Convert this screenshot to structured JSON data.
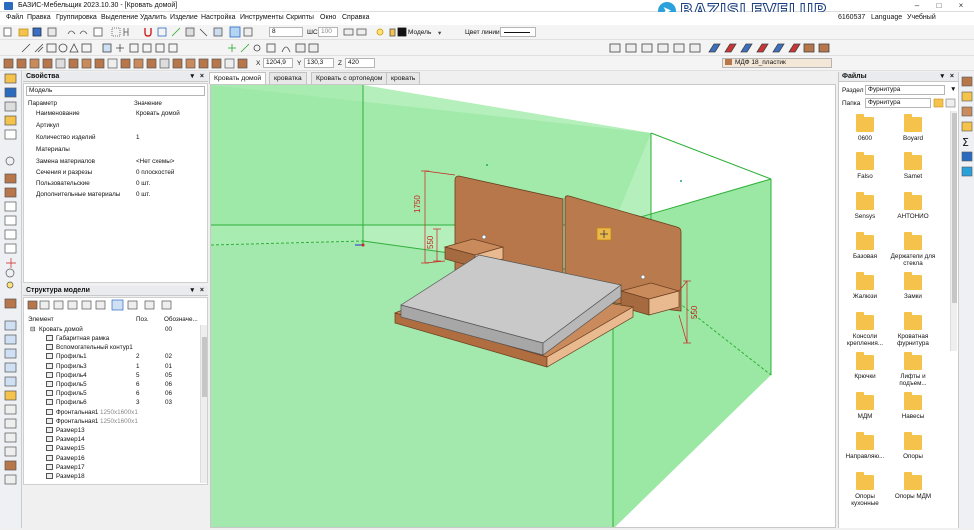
{
  "window": {
    "title": "БАЗИС-Мебельщик 2023.10.30 - [Кровать домой]"
  },
  "watermark": {
    "text": "BAZISLEVELUP"
  },
  "menu": [
    "Файл",
    "Правка",
    "Группировка",
    "Выделение",
    "Удалить",
    "Изделие",
    "Настройка",
    "Инструменты",
    "Скрипты",
    "Окно",
    "Справка"
  ],
  "menu_right": {
    "code": "6160537",
    "language": "Language",
    "mode": "Учебный"
  },
  "toolbar1": {
    "layer_value": "8",
    "shc_label": "ШС",
    "shc_value": "100",
    "model_value": "Модель",
    "line_color_label": "Цвет линии"
  },
  "toolbar2": {
    "material": "МДФ 18_пластик"
  },
  "coords": {
    "x_label": "X",
    "x_value": "1204,9",
    "y_label": "Y",
    "y_value": "130,3",
    "z_label": "Z",
    "z_value": "420"
  },
  "properties": {
    "title": "Свойства",
    "selector": "Модель",
    "col_param": "Параметр",
    "col_value": "Значение",
    "rows": [
      {
        "param": "Наименование",
        "value": "Кровать домой"
      },
      {
        "param": "Артикул",
        "value": ""
      },
      {
        "param": "Количество изделий",
        "value": "1"
      },
      {
        "param": "Материалы",
        "value": ""
      },
      {
        "param": "Замена материалов",
        "value": "<Нет схемы>"
      },
      {
        "param": "Сечения и разрезы",
        "value": "0 плоскостей"
      },
      {
        "param": "Пользовательские",
        "value": "0 шт."
      },
      {
        "param": "Дополнительные материалы",
        "value": "0 шт."
      }
    ]
  },
  "structure": {
    "title": "Структура модели",
    "col_element": "Элемент",
    "col_pos": "Поз.",
    "col_code": "Обозначе...",
    "root": {
      "name": "Кровать домой",
      "code": "00"
    },
    "items": [
      {
        "name": "Габаритная рамка",
        "pos": "",
        "code": "",
        "size": ""
      },
      {
        "name": "Вспомогательный контур1",
        "pos": "",
        "code": "",
        "size": ""
      },
      {
        "name": "Профиль1",
        "pos": "2",
        "code": "02",
        "size": ""
      },
      {
        "name": "Профиль3",
        "pos": "1",
        "code": "01",
        "size": ""
      },
      {
        "name": "Профиль4",
        "pos": "5",
        "code": "05",
        "size": ""
      },
      {
        "name": "Профиль5",
        "pos": "6",
        "code": "06",
        "size": ""
      },
      {
        "name": "Профиль5",
        "pos": "6",
        "code": "06",
        "size": ""
      },
      {
        "name": "Профиль6",
        "pos": "3",
        "code": "03",
        "size": ""
      },
      {
        "name": "Фронтальная1",
        "pos": "",
        "code": "",
        "size": "1250x1600x1"
      },
      {
        "name": "Фронтальная1",
        "pos": "",
        "code": "",
        "size": "1250x1600x1"
      },
      {
        "name": "Размер13",
        "pos": "",
        "code": "",
        "size": ""
      },
      {
        "name": "Размер14",
        "pos": "",
        "code": "",
        "size": ""
      },
      {
        "name": "Размер15",
        "pos": "",
        "code": "",
        "size": ""
      },
      {
        "name": "Размер16",
        "pos": "",
        "code": "",
        "size": ""
      },
      {
        "name": "Размер17",
        "pos": "",
        "code": "",
        "size": ""
      },
      {
        "name": "Размер18",
        "pos": "",
        "code": "",
        "size": ""
      }
    ]
  },
  "tabs": [
    "Кровать домой",
    "кроватка",
    "Кровать с ортопедом",
    "кровать"
  ],
  "drawing": {
    "dim_1750": "1750",
    "dim_550_left": "550",
    "dim_550_right": "550"
  },
  "files": {
    "title": "Файлы",
    "section_label": "Раздел",
    "section_value": "Фурнитура",
    "folder_label": "Папка",
    "folder_value": "Фурнитура",
    "folders": [
      "0600",
      "Boyard",
      "Falso",
      "Samet",
      "Sensys",
      "АНТОНИО",
      "Базовая",
      "Держатели для стекла",
      "Жалюзи",
      "Замки",
      "Консоли крепления...",
      "Кроватная фурнитура",
      "Крючки",
      "Лифты и подъем...",
      "МДМ",
      "Навесы",
      "Направляю...",
      "Опоры",
      "Опоры кухонные",
      "Опоры МДМ"
    ]
  },
  "colors": {
    "accent": "#2b6bbf",
    "box_fill": "#9be8a4",
    "box_edge": "#2fb03a",
    "wood": "#b7774b",
    "mattress": "#c9c9c9",
    "dim": "#cc2222",
    "folder": "#f5c24b"
  }
}
